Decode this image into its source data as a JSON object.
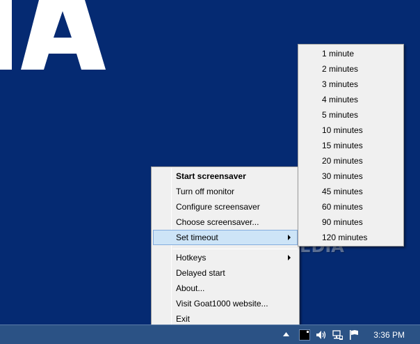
{
  "main_menu": {
    "items": [
      {
        "label": "Start screensaver",
        "bold": true
      },
      {
        "label": "Turn off monitor"
      },
      {
        "label": "Configure screensaver"
      },
      {
        "label": "Choose screensaver..."
      },
      {
        "label": "Set timeout",
        "submenu": true,
        "highlighted": true
      },
      {
        "label": "Hotkeys",
        "submenu": true
      },
      {
        "label": "Delayed start"
      },
      {
        "label": "About..."
      },
      {
        "label": "Visit Goat1000 website..."
      },
      {
        "label": "Exit"
      }
    ]
  },
  "timeout_menu": {
    "items": [
      "1 minute",
      "2 minutes",
      "3 minutes",
      "4 minutes",
      "5 minutes",
      "10 minutes",
      "15 minutes",
      "20 minutes",
      "30 minutes",
      "45 minutes",
      "60 minutes",
      "90 minutes",
      "120 minutes"
    ]
  },
  "watermark": "SOFTPEDIA",
  "taskbar": {
    "clock": "3:36 PM",
    "tray_icons": [
      "show-hidden-icons-arrow",
      "screensaver-tray-icon",
      "volume-icon",
      "network-icon",
      "action-center-flag-icon"
    ]
  },
  "colors": {
    "desktop": "#062a72",
    "taskbar": "#2b5285",
    "menu_bg": "#f0f0f0",
    "highlight": "#cde4f7"
  }
}
